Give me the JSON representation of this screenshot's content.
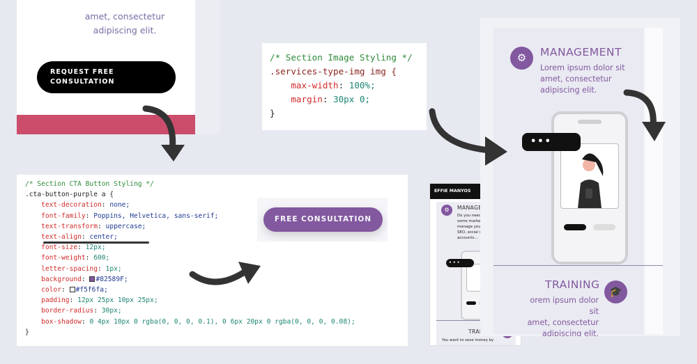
{
  "original_cta": {
    "lorem_line1": "amet, consectetur",
    "lorem_line2": "adipiscing elit.",
    "button_line1": "REQUEST FREE",
    "button_line2": "CONSULTATION",
    "colors": {
      "button_bg": "#000000",
      "accent_band": "#cb4d6b"
    }
  },
  "cta_code": {
    "comment": "/* Section CTA Button Styling */",
    "selector": ".cta-button-purple a {",
    "props": [
      {
        "prop": "text-decoration",
        "value": "none;"
      },
      {
        "prop": "font-family",
        "value": "Poppins, Helvetica, sans-serif;"
      },
      {
        "prop": "text-transform",
        "value": "uppercase;"
      },
      {
        "prop": "text-align",
        "value": "center;"
      },
      {
        "prop": "font-size",
        "value": "12px;"
      },
      {
        "prop": "font-weight",
        "value": "600;"
      },
      {
        "prop": "letter-spacing",
        "value": "1px;"
      },
      {
        "prop": "background",
        "value": "#82589F;"
      },
      {
        "prop": "color",
        "value": "#f5f6fa;"
      },
      {
        "prop": "padding",
        "value": "12px 25px 10px 25px;"
      },
      {
        "prop": "border-radius",
        "value": "30px;"
      },
      {
        "prop": "box-shadow",
        "value": "0 4px 10px 0 rgba(0, 0, 0, 0.1), 0 6px 20px 0 rgba(0, 0, 0, 0.08);"
      }
    ],
    "close": "}"
  },
  "new_cta": {
    "button_label": "FREE CONSULTATION",
    "colors": {
      "bg": "#82589f",
      "fg": "#f5f6fa"
    }
  },
  "img_code": {
    "comment": "/* Section Image Styling */",
    "selector": ".services-type-img img {",
    "props": [
      {
        "prop": "max-width",
        "value": "100%;"
      },
      {
        "prop": "margin",
        "value": "30px 0;"
      }
    ],
    "close": "}"
  },
  "mobile": {
    "brand": "EFFIE MANYOS",
    "menu_icon": "hamburger-icon",
    "management_title": "MANAGEMENT",
    "management_text": [
      "Do you need to outsource",
      "some marketing tasks? I can",
      "manage your campaigns,",
      "SEO, social media",
      "accounts..."
    ],
    "bubble": "•••",
    "training_title": "TRAINING",
    "training_text": "You want to save money by"
  },
  "tablet": {
    "management_title": "MANAGEMENT",
    "management_text": [
      "Lorem ipsum dolor sit",
      "amet, consectetur",
      "adipiscing elit."
    ],
    "bubble": "•••",
    "training_title": "TRAINING",
    "training_text": [
      "orem ipsum dolor sit",
      "amet, consectetur",
      "adipiscing elit."
    ],
    "icons": [
      "gears-icon",
      "graduation-cap-icon"
    ],
    "accent": "#82589f"
  }
}
